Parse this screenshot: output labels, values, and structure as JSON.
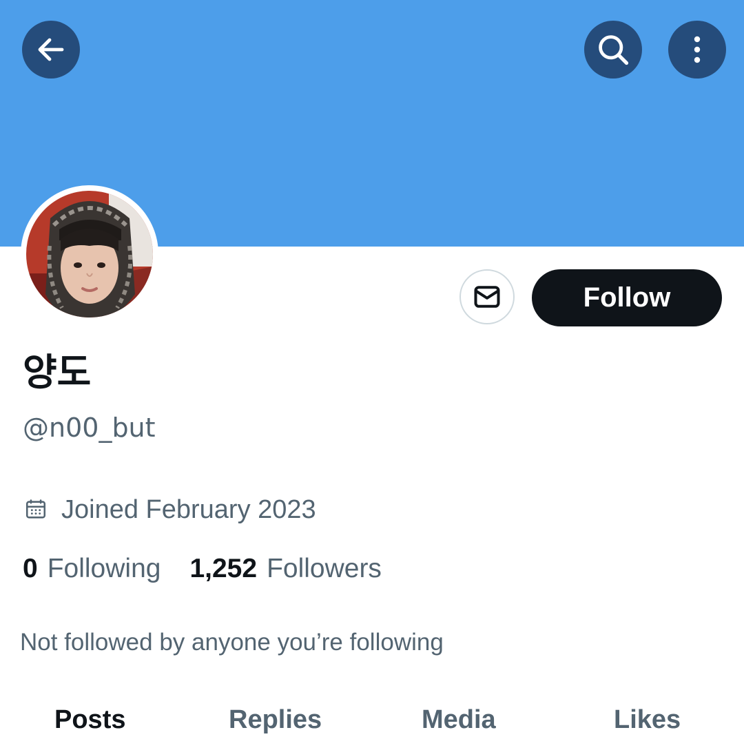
{
  "header": {
    "back_icon": "arrow-left-icon",
    "search_icon": "search-icon",
    "more_icon": "more-vertical-icon",
    "banner_color": "#4d9eea"
  },
  "profile": {
    "display_name": "양도",
    "handle": "@n00_but",
    "joined": "Joined February 2023",
    "joined_icon": "calendar-icon",
    "following_count": "0",
    "following_label": "Following",
    "followers_count": "1,252",
    "followers_label": "Followers",
    "mutual_note": "Not followed by anyone you’re following"
  },
  "actions": {
    "message_icon": "mail-icon",
    "follow_label": "Follow"
  },
  "tabs": [
    {
      "label": "Posts",
      "active": true
    },
    {
      "label": "Replies",
      "active": false
    },
    {
      "label": "Media",
      "active": false
    },
    {
      "label": "Likes",
      "active": false
    }
  ],
  "colors": {
    "primary_text": "#0f1419",
    "secondary_text": "#536471",
    "follow_button_bg": "#0f1419"
  }
}
